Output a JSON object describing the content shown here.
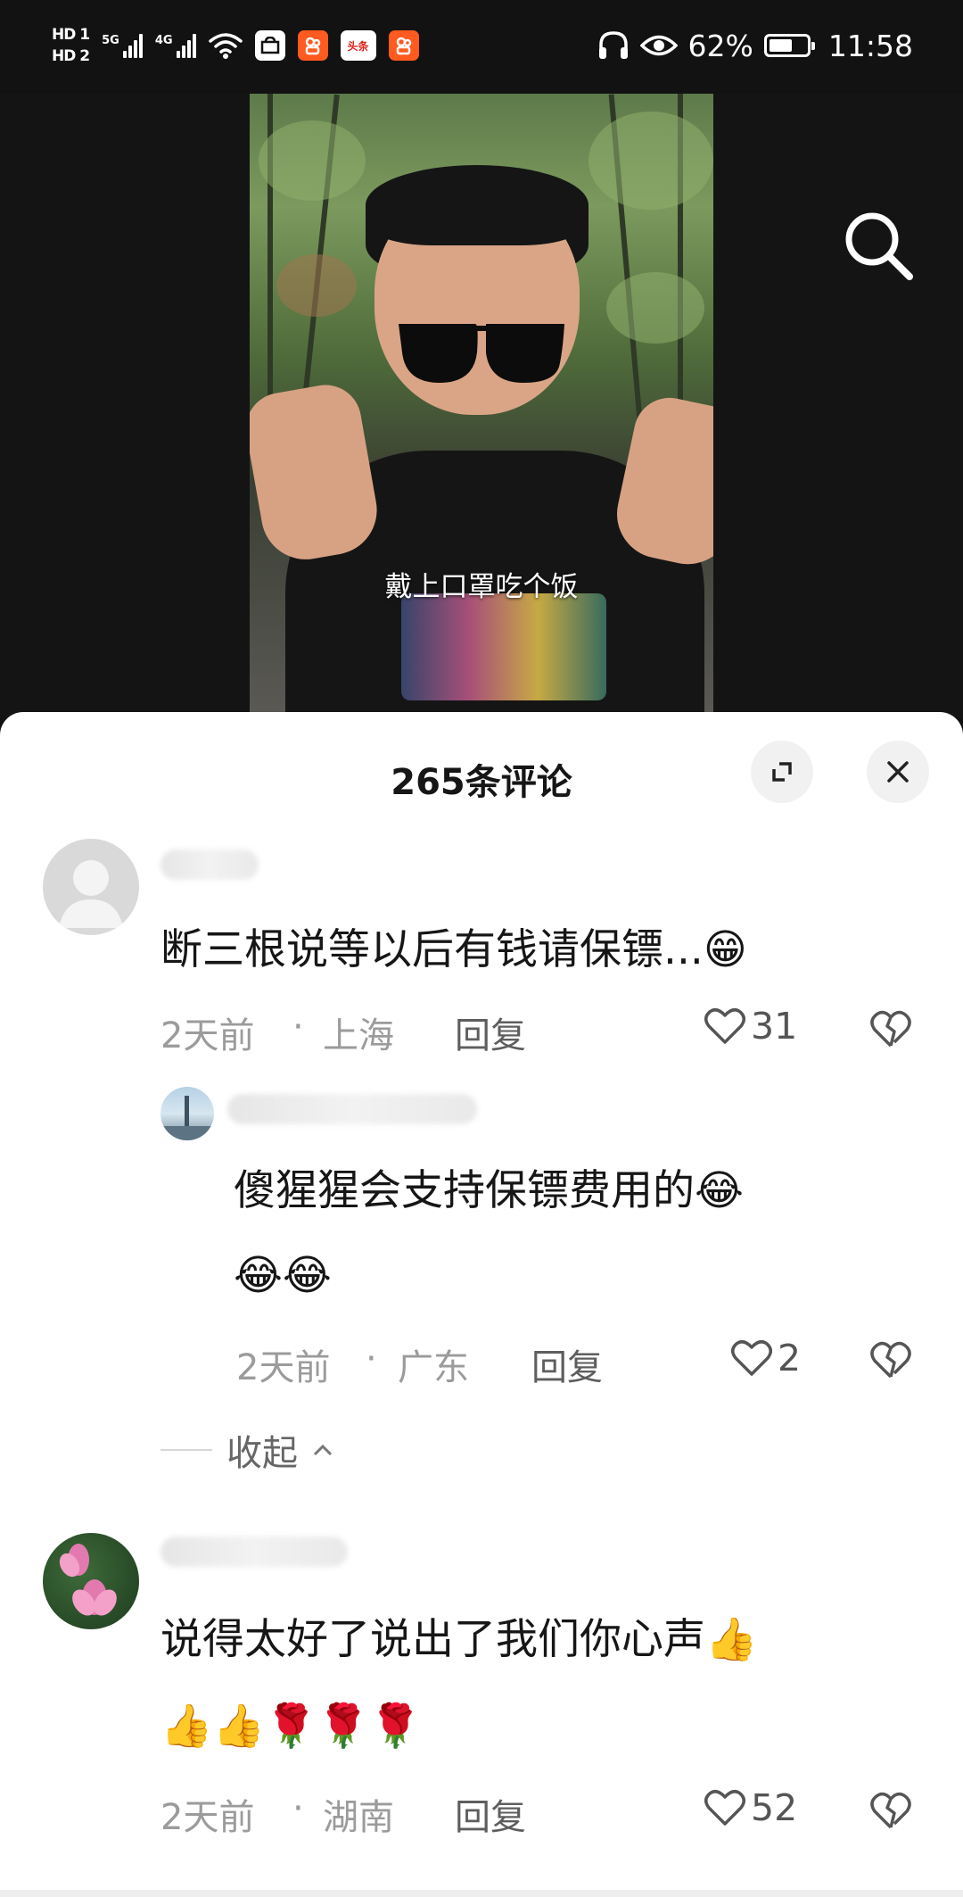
{
  "status_bar": {
    "sim1": "HD 1",
    "sim2": "HD 2",
    "net1": "5G",
    "net2": "4G",
    "app_toutiao": "头条",
    "battery": "62%",
    "time": "11:58"
  },
  "video": {
    "subtitle": "戴上口罩吃个饭"
  },
  "comments_panel": {
    "title": "265条评论",
    "comments": [
      {
        "text": "断三根说等以后有钱请保镖...😁",
        "time": "2天前",
        "location": "上海",
        "reply_label": "回复",
        "likes": "31"
      },
      {
        "text_line1": "傻猩猩会支持保镖费用的😂",
        "text_line2": "😂😂",
        "time": "2天前",
        "location": "广东",
        "reply_label": "回复",
        "likes": "2"
      },
      {
        "text_line1": "说得太好了说出了我们你心声👍",
        "text_line2": "👍👍🌹🌹🌹",
        "time": "2天前",
        "location": "湖南",
        "reply_label": "回复",
        "likes": "52"
      }
    ],
    "collapse_label": "收起"
  },
  "colors": {
    "sheet_bg": "#ffffff",
    "meta_text": "#9b9b9b",
    "status_bg": "#121212"
  },
  "battery_level": 0.62
}
